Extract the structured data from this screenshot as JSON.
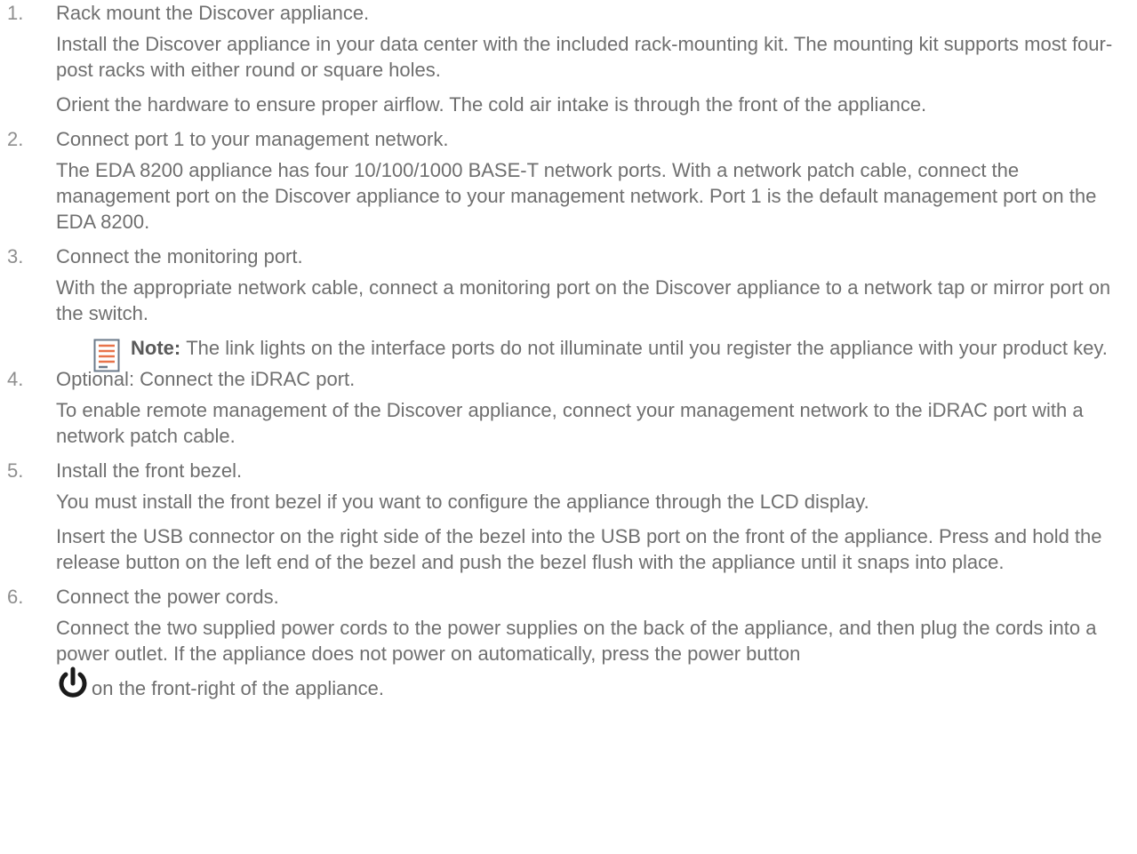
{
  "steps": [
    {
      "num": "1.",
      "title": "Rack mount the Discover appliance.",
      "paragraphs": [
        "Install the Discover appliance in your data center with the included rack-mounting kit. The mounting kit supports most four-post racks with either round or square holes.",
        "Orient the hardware to ensure proper airflow. The cold air intake is through the front of the appliance."
      ]
    },
    {
      "num": "2.",
      "title": "Connect port 1 to your management network.",
      "paragraphs": [
        "The EDA 8200 appliance has four 10/100/1000 BASE-T network ports. With a network patch cable, connect the management port on the Discover appliance to your management network. Port 1 is the default management port on the EDA 8200."
      ]
    },
    {
      "num": "3.",
      "title": "Connect the monitoring port.",
      "paragraphs": [
        "With the appropriate network cable, connect a monitoring port on the Discover appliance to a network tap or mirror port on the switch."
      ],
      "note": {
        "label": "Note:",
        "text": "The link lights on the interface ports do not illuminate until you register the appliance with your product key.",
        "icon": "note-icon"
      }
    },
    {
      "num": "4.",
      "title": "Optional: Connect the iDRAC port.",
      "paragraphs": [
        "To enable remote management of the Discover appliance, connect your management network to the iDRAC port with a network patch cable."
      ]
    },
    {
      "num": "5.",
      "title": "Install the front bezel.",
      "paragraphs": [
        "You must install the front bezel if you want to configure the appliance through the LCD display.",
        "Insert the USB connector on the right side of the bezel into the USB port on the front of the appliance. Press and hold the release button on the left end of the bezel and push the bezel flush with the appliance until it snaps into place."
      ]
    },
    {
      "num": "6.",
      "title": "Connect the power cords.",
      "paragraphs": [
        "Connect the two supplied power cords to the power supplies on the back of the appliance, and then plug the cords into a power outlet. If the appliance does not power on automatically, press the power button"
      ],
      "tail": {
        "icon": "power-icon",
        "text": "on the front-right of the appliance."
      }
    }
  ],
  "colors": {
    "text": "#6f6f6f",
    "number": "#8e8e8e",
    "note_icon_lines": "#e8734a",
    "note_icon_border": "#6b7a8a",
    "power_icon": "#1a1a1a"
  }
}
